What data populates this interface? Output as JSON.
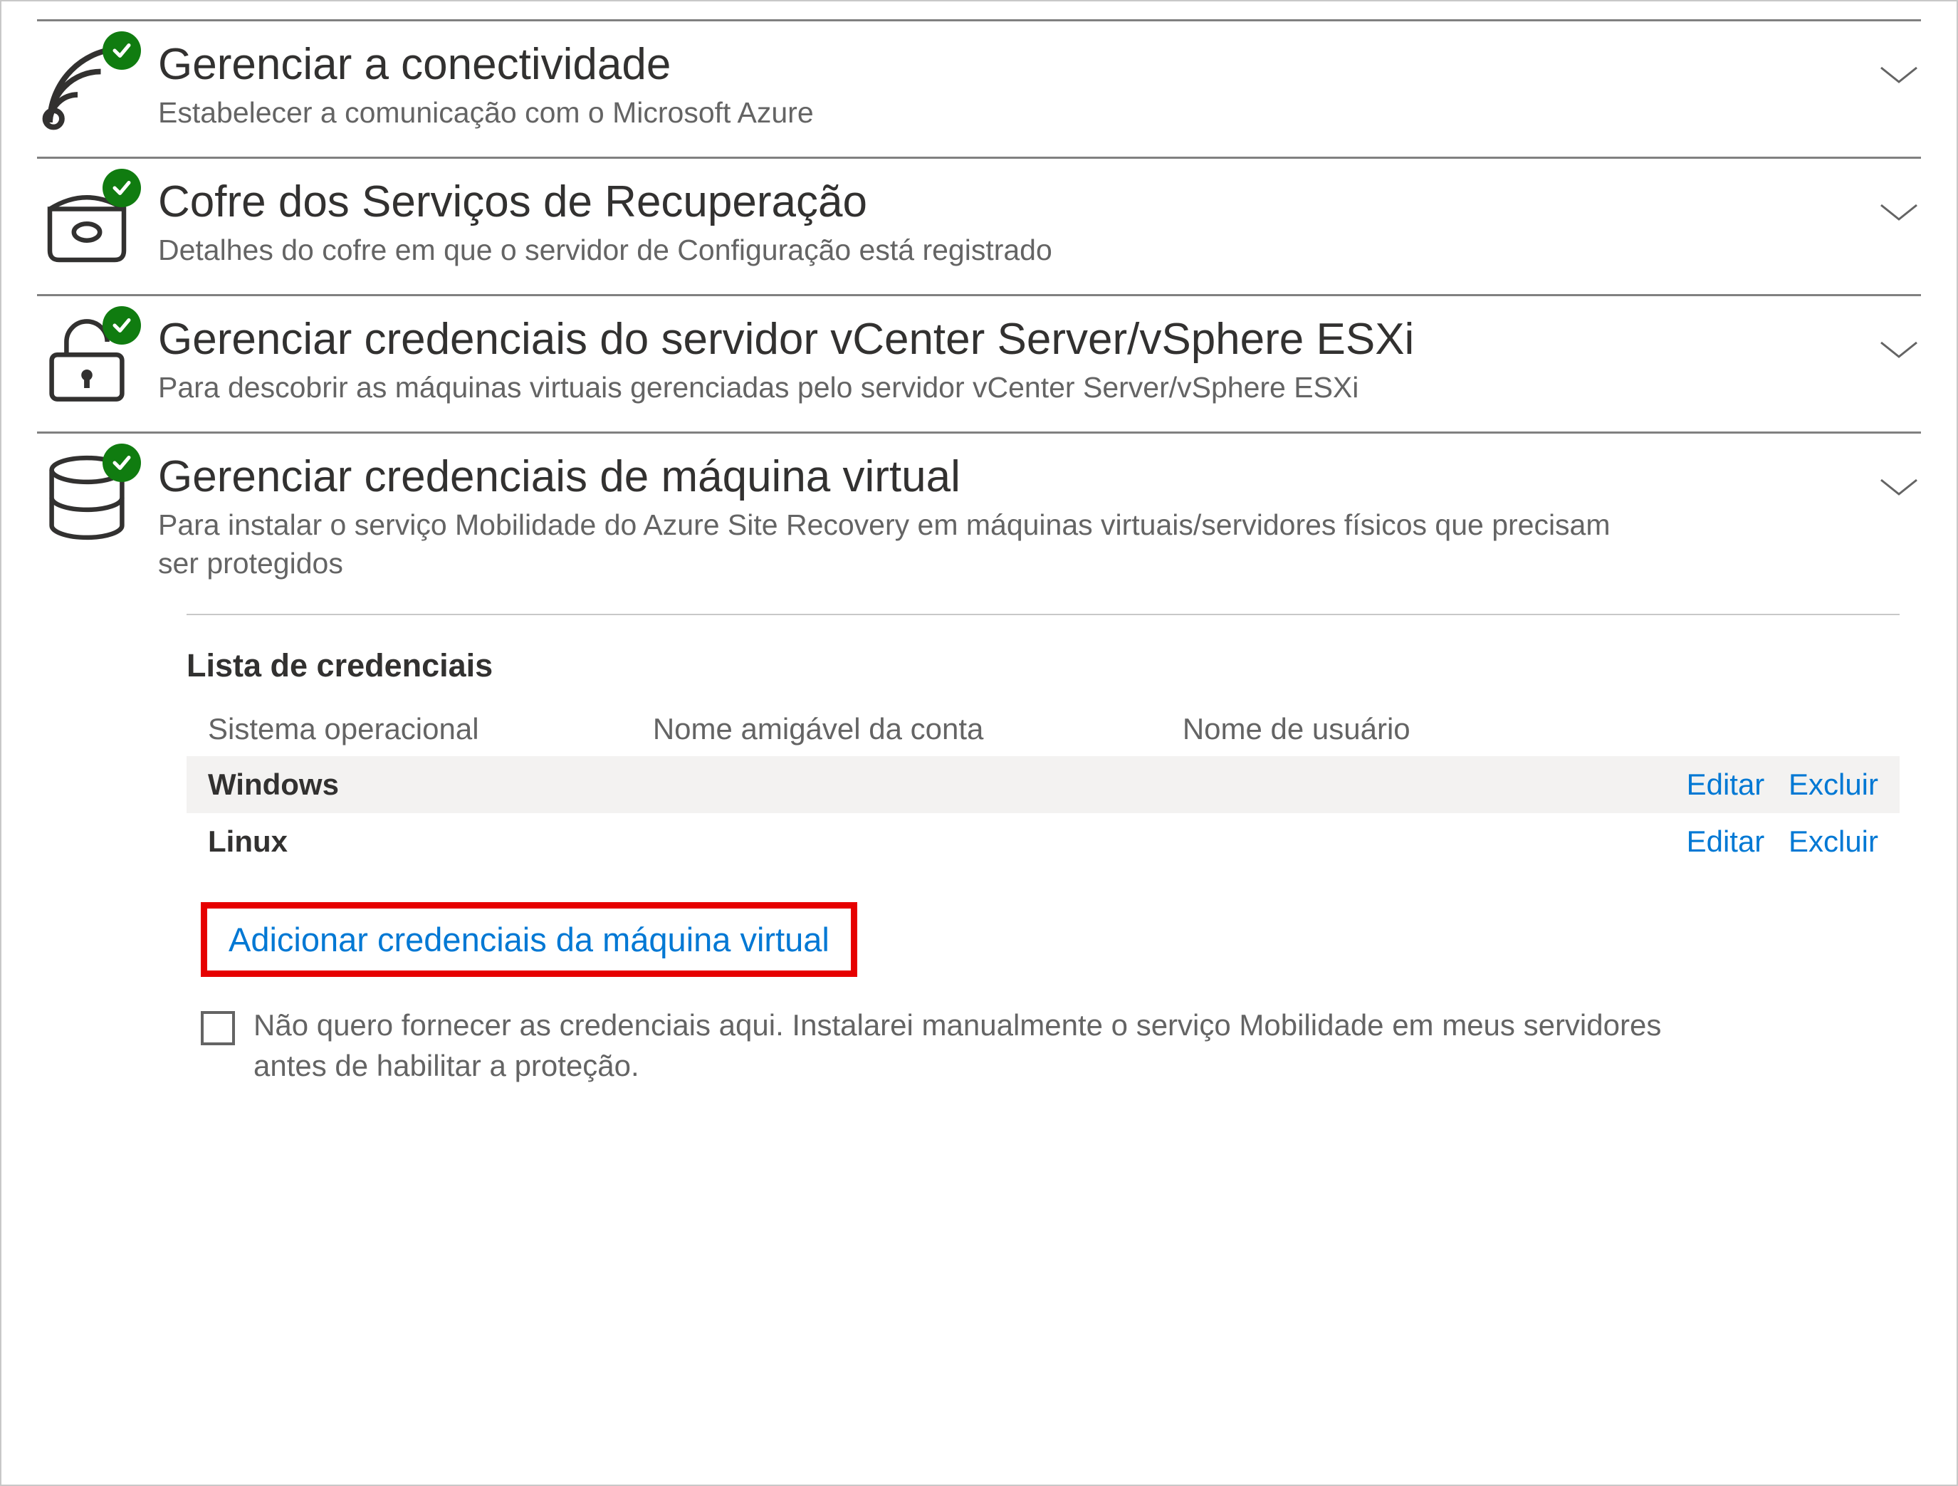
{
  "sections": {
    "connectivity": {
      "title": "Gerenciar a conectividade",
      "subtitle": "Estabelecer a comunicação com o Microsoft Azure"
    },
    "vault": {
      "title": "Cofre dos Serviços de Recuperação",
      "subtitle": "Detalhes do cofre em que o servidor de Configuração está registrado"
    },
    "vcenter": {
      "title": "Gerenciar credenciais do servidor vCenter Server/vSphere ESXi",
      "subtitle": "Para descobrir as máquinas virtuais gerenciadas pelo servidor vCenter Server/vSphere ESXi"
    },
    "vmcred": {
      "title": "Gerenciar credenciais de máquina virtual",
      "subtitle": "Para instalar o serviço Mobilidade do Azure Site Recovery em máquinas virtuais/servidores físicos que precisam ser protegidos"
    }
  },
  "credentials": {
    "heading": "Lista de credenciais",
    "columns": {
      "os": "Sistema operacional",
      "friendly": "Nome amigável da conta",
      "user": "Nome de usuário"
    },
    "rows": [
      {
        "os": "Windows",
        "friendly": "",
        "user": ""
      },
      {
        "os": "Linux",
        "friendly": "",
        "user": ""
      }
    ],
    "actions": {
      "edit": "Editar",
      "delete": "Excluir"
    },
    "add_label": "Adicionar credenciais da máquina virtual",
    "optout_label": "Não quero fornecer as credenciais aqui. Instalarei manualmente o serviço Mobilidade em meus servidores antes de habilitar a proteção."
  }
}
